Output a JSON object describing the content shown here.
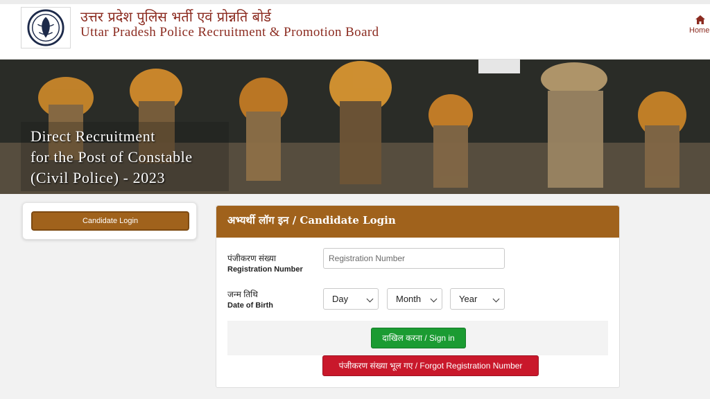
{
  "header": {
    "title_hindi": "उत्तर प्रदेश पुलिस भर्ती एवं प्रोन्नति बोर्ड",
    "title_english": "Uttar Pradesh Police Recruitment & Promotion Board",
    "home_label": "Home",
    "logo_icon": "up-police-emblem-icon",
    "home_icon": "home-icon"
  },
  "banner": {
    "text": "Direct Recruitment\nfor the Post of Constable\n(Civil Police) - 2023"
  },
  "sidebar": {
    "candidate_login_label": "Candidate Login"
  },
  "login_panel": {
    "title": "अभ्यर्थी लॉग इन / Candidate Login",
    "registration_label_hindi": "पंजीकरण संख्या",
    "registration_label_english": "Registration Number",
    "registration_placeholder": "Registration Number",
    "registration_value": "",
    "dob_label_hindi": "जन्म तिथि",
    "dob_label_english": "Date of Birth",
    "day_selected": "Day",
    "month_selected": "Month",
    "year_selected": "Year",
    "signin_label": "दाखिल करना / Sign in",
    "forgot_label": "पंजीकरण संख्या भूल गए / Forgot Registration Number"
  },
  "colors": {
    "brand_maroon": "#8b2b20",
    "panel_brown": "#a0621c",
    "signin_green": "#1b9b32",
    "forgot_red": "#c9182b"
  }
}
